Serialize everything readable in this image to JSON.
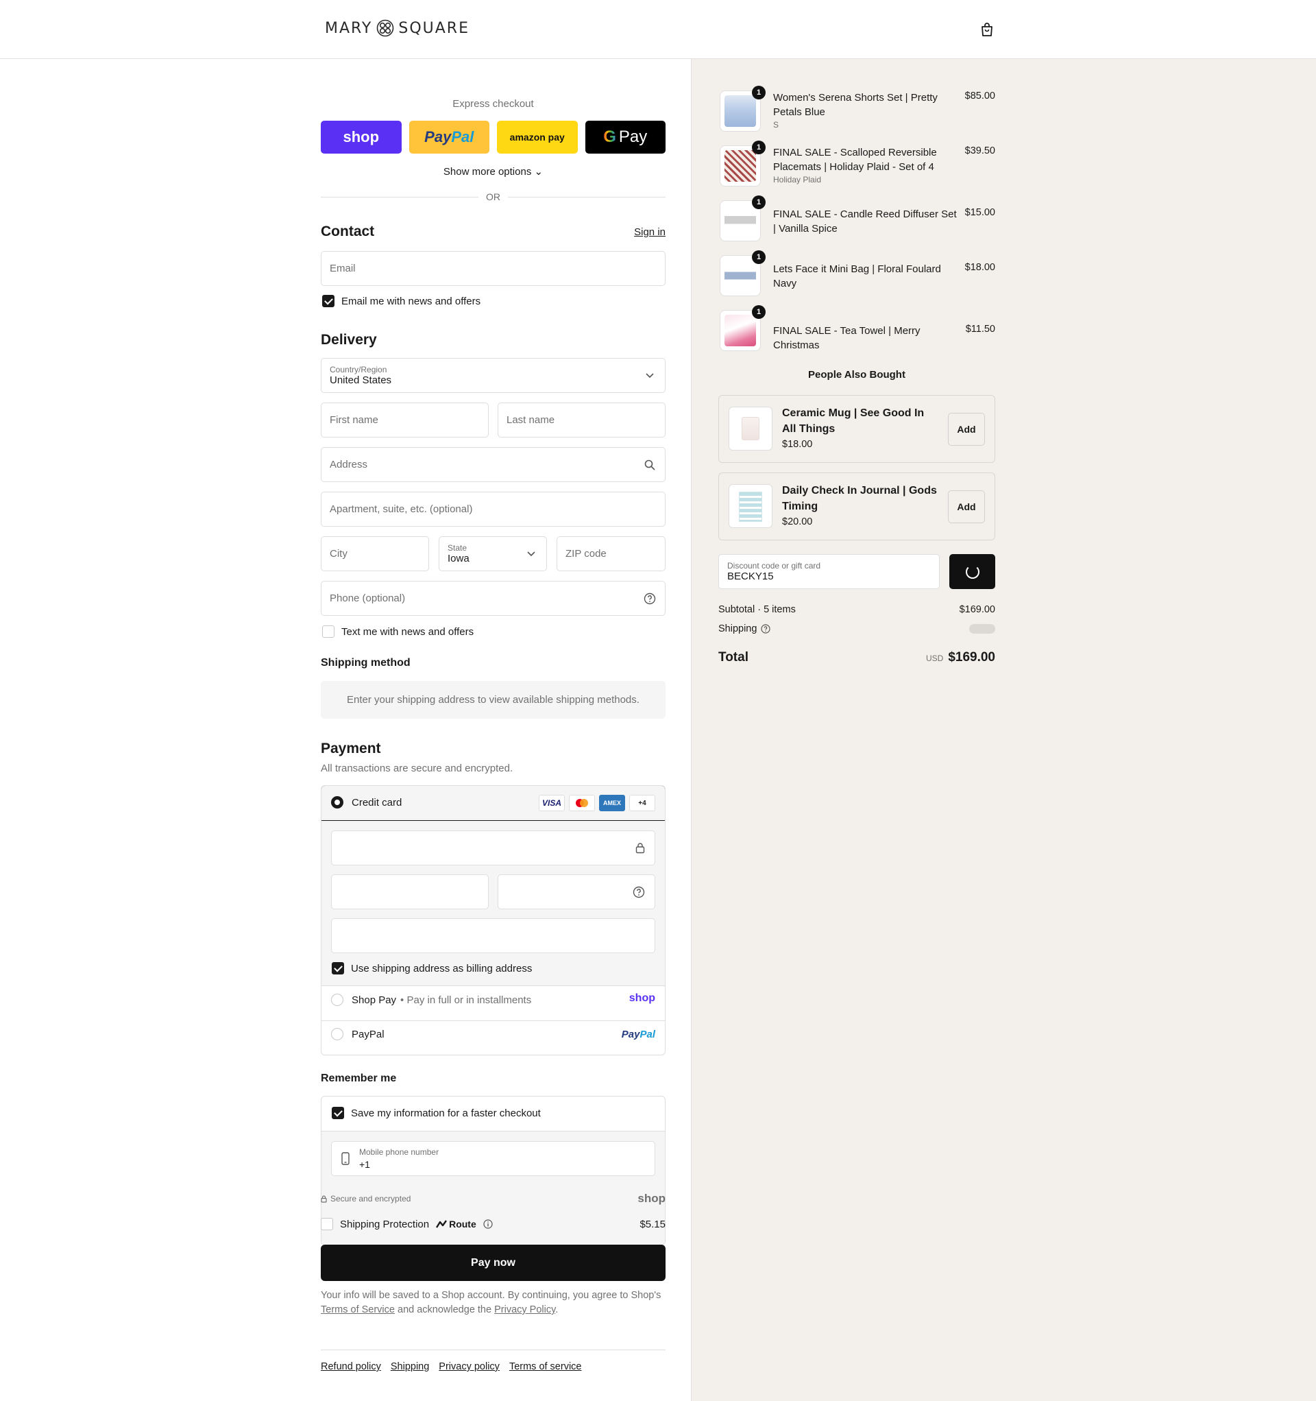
{
  "brand": {
    "name_left": "MARY",
    "name_right": "SQUARE"
  },
  "express": {
    "label": "Express checkout",
    "shop_label": "shop",
    "paypal_a": "Pay",
    "paypal_b": "Pal",
    "amazon_label": "amazon pay",
    "gpay_g": "G",
    "gpay_label": "Pay",
    "show_more": "Show more options ⌄",
    "or": "OR"
  },
  "contact": {
    "title": "Contact",
    "sign_in": "Sign in",
    "email_placeholder": "Email",
    "news_label": "Email me with news and offers",
    "news_checked": true
  },
  "delivery": {
    "title": "Delivery",
    "country_label": "Country/Region",
    "country_value": "United States",
    "first_name": "First name",
    "last_name": "Last name",
    "address": "Address",
    "apartment": "Apartment, suite, etc. (optional)",
    "city": "City",
    "state_label": "State",
    "state_value": "Iowa",
    "zip": "ZIP code",
    "phone": "Phone (optional)",
    "text_label": "Text me with news and offers",
    "text_checked": false
  },
  "shipping_method": {
    "title": "Shipping method",
    "message": "Enter your shipping address to view available shipping methods."
  },
  "payment": {
    "title": "Payment",
    "subtitle": "All transactions are secure and encrypted.",
    "credit_card": "Credit card",
    "card_logos": [
      "VISA",
      "MC",
      "AMEX",
      "+4"
    ],
    "billing_label": "Use shipping address as billing address",
    "shop_pay": "Shop Pay",
    "shop_pay_sub": "• Pay in full or in installments",
    "shop_brand": "shop",
    "paypal": "PayPal",
    "paypal_a": "Pay",
    "paypal_b": "Pal"
  },
  "remember": {
    "title": "Remember me",
    "save_label": "Save my information for a faster checkout",
    "phone_label": "Mobile phone number",
    "phone_value": "+1",
    "secure": "Secure and encrypted",
    "shop_brand": "shop"
  },
  "protection": {
    "label": "Shipping Protection",
    "route": "Route",
    "price": "$5.15"
  },
  "pay_now": "Pay now",
  "legal": {
    "text_1": "Your info will be saved to a Shop account. By continuing, you agree to Shop's",
    "terms": "Terms of Service",
    "text_2": "and acknowledge the",
    "privacy": "Privacy Policy",
    "text_3": "."
  },
  "footer": [
    "Refund policy",
    "Shipping",
    "Privacy policy",
    "Terms of service"
  ],
  "cart": {
    "items": [
      {
        "name": "Women's Serena Shorts Set | Pretty Petals Blue",
        "variant": "S",
        "price": "$85.00",
        "qty": "1",
        "thumb_color": "#b9cce8"
      },
      {
        "name": "FINAL SALE - Scalloped Reversible Placemats | Holiday Plaid - Set of 4",
        "variant": "Holiday Plaid",
        "price": "$39.50",
        "qty": "1",
        "thumb_color": "#a94a4a"
      },
      {
        "name": "FINAL SALE - Candle Reed Diffuser Set | Vanilla Spice",
        "variant": "",
        "price": "$15.00",
        "qty": "1",
        "thumb_color": "#d5d5d5"
      },
      {
        "name": "Lets Face it Mini Bag | Floral Foulard Navy",
        "variant": "",
        "price": "$18.00",
        "qty": "1",
        "thumb_color": "#9fb2cf"
      },
      {
        "name": "FINAL SALE - Tea Towel | Merry Christmas",
        "variant": "",
        "price": "$11.50",
        "qty": "1",
        "thumb_color": "#e87aa0"
      }
    ],
    "people_also_bought": "People Also Bought",
    "upsells": [
      {
        "name": "Ceramic Mug | See Good In All Things",
        "price": "$18.00",
        "add": "Add"
      },
      {
        "name": "Daily Check In Journal | Gods Timing",
        "price": "$20.00",
        "add": "Add"
      }
    ],
    "discount_label": "Discount code or gift card",
    "discount_value": "BECKY15",
    "subtotal_label": "Subtotal · 5 items",
    "subtotal_value": "$169.00",
    "shipping_label": "Shipping",
    "total_label": "Total",
    "total_currency": "USD",
    "total_value": "$169.00"
  }
}
